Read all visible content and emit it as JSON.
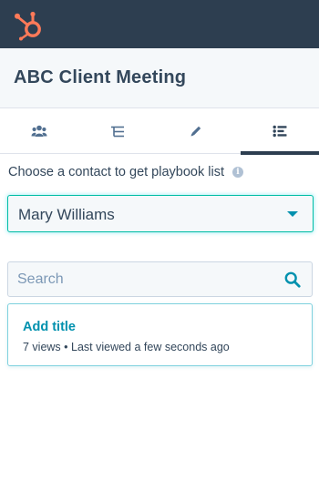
{
  "header": {
    "logo_icon": "hubspot-sprocket-icon",
    "brand_color": "#ff7a59",
    "bar_color": "#2d3e50"
  },
  "meeting": {
    "title": "ABC Client Meeting"
  },
  "tabs": [
    {
      "icon": "contacts-icon",
      "active": false
    },
    {
      "icon": "hierarchy-icon",
      "active": false
    },
    {
      "icon": "pencil-icon",
      "active": false
    },
    {
      "icon": "playbook-list-icon",
      "active": true
    }
  ],
  "playbook": {
    "prompt": "Choose a contact to get playbook list",
    "info_icon": "info-icon",
    "contact_select": {
      "value": "Mary Williams"
    },
    "search": {
      "placeholder": "Search",
      "value": ""
    },
    "items": [
      {
        "title": "Add title",
        "meta": "7 views • Last viewed a few seconds ago"
      }
    ]
  },
  "colors": {
    "accent": "#0091ae",
    "focus_border": "#00bda5",
    "text": "#33475b"
  }
}
